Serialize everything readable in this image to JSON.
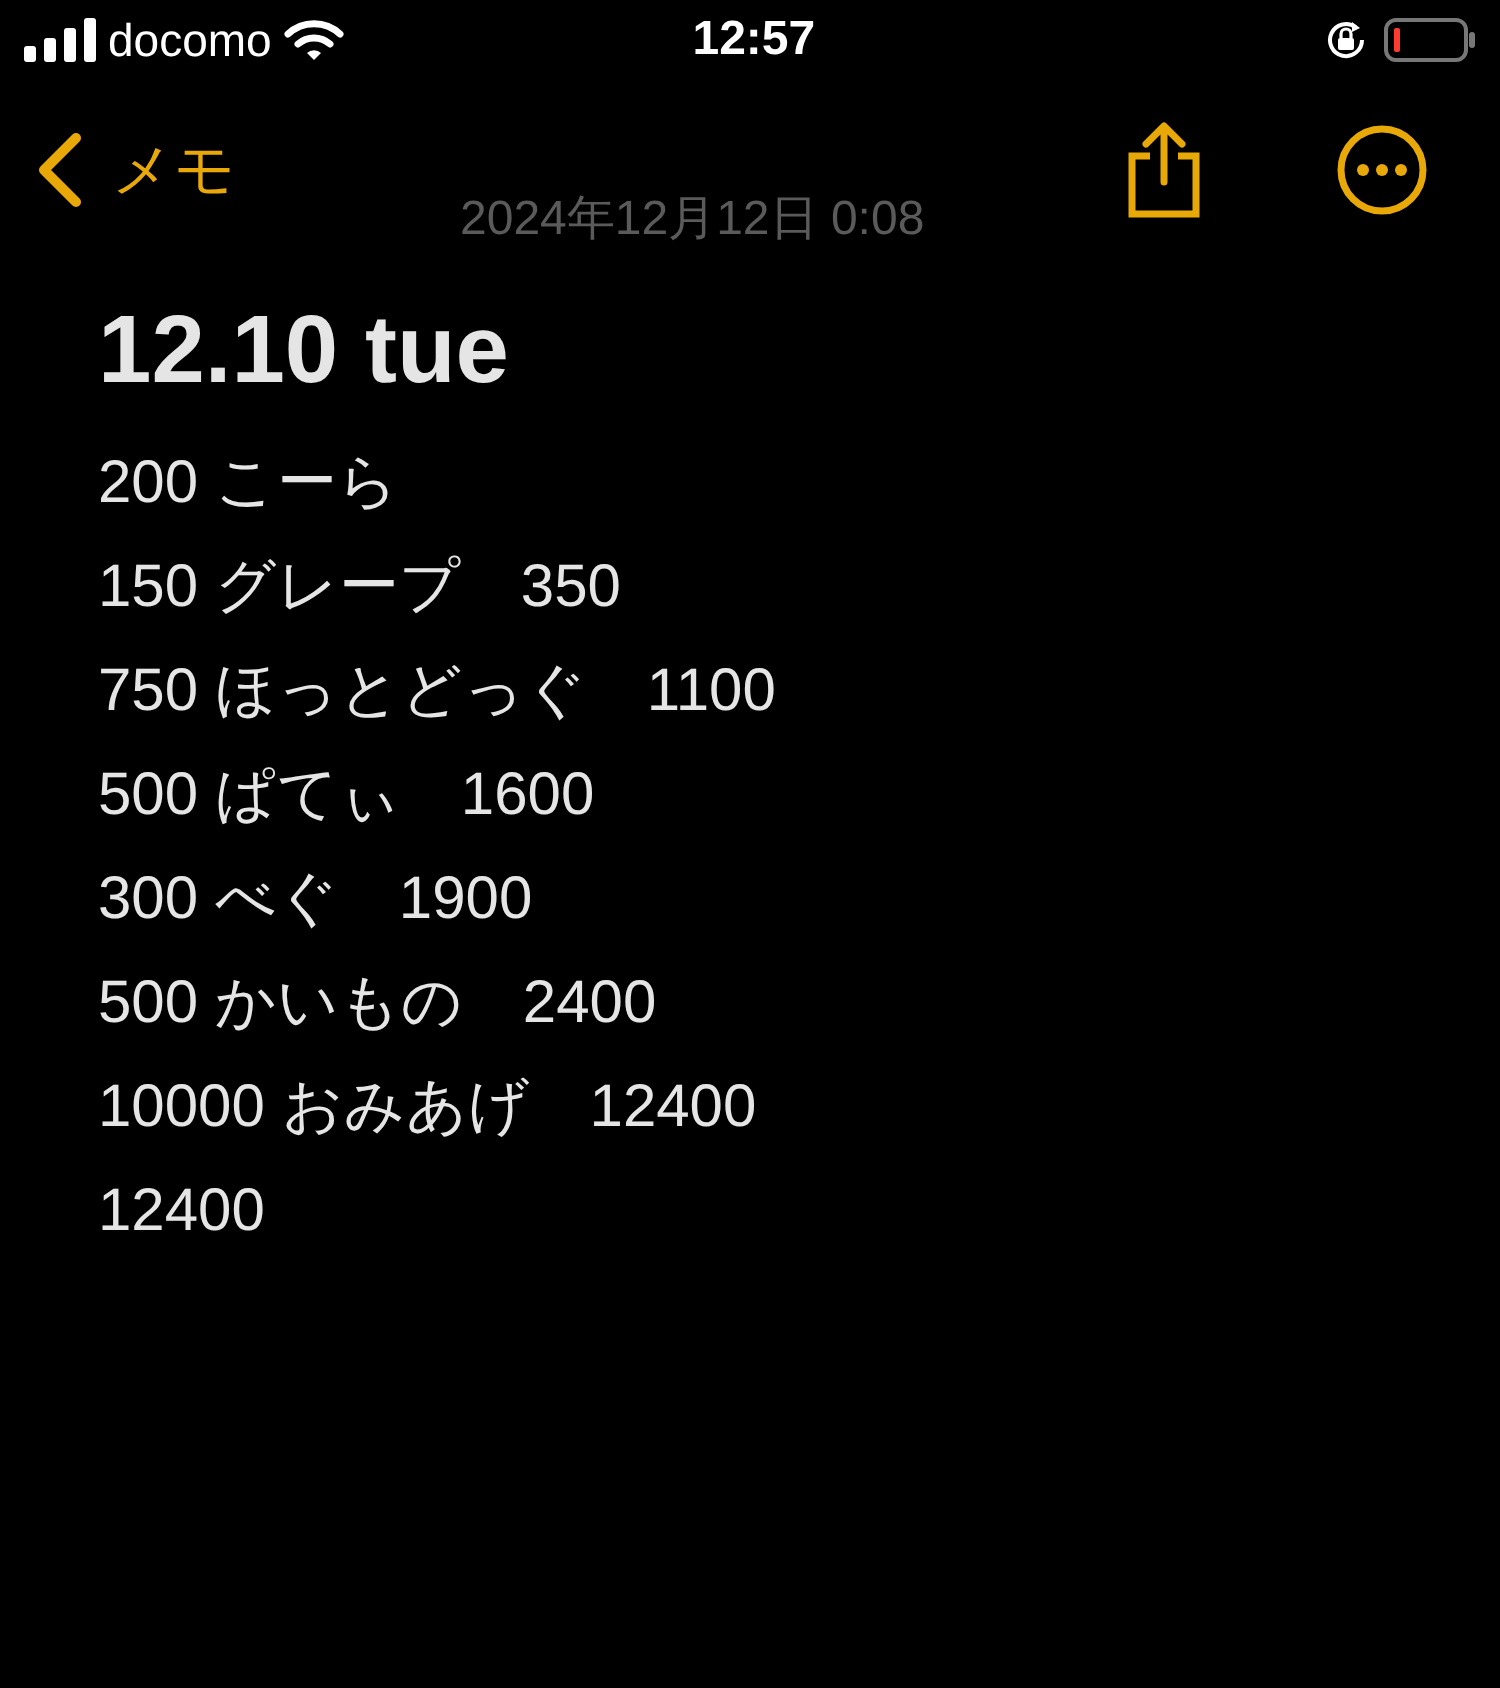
{
  "status_bar": {
    "carrier": "docomo",
    "time": "12:57"
  },
  "nav": {
    "back_label": "メモ",
    "date": "2024年12月12日 0:08"
  },
  "note": {
    "title": "12.10 tue",
    "lines": [
      "200 こーら",
      "150 グレープ　350",
      "750 ほっとどっぐ　1100",
      "500 ぱてぃ　1600",
      "300 べぐ　1900",
      "500 かいもの　2400",
      "10000 おみあげ　12400",
      "12400"
    ]
  }
}
